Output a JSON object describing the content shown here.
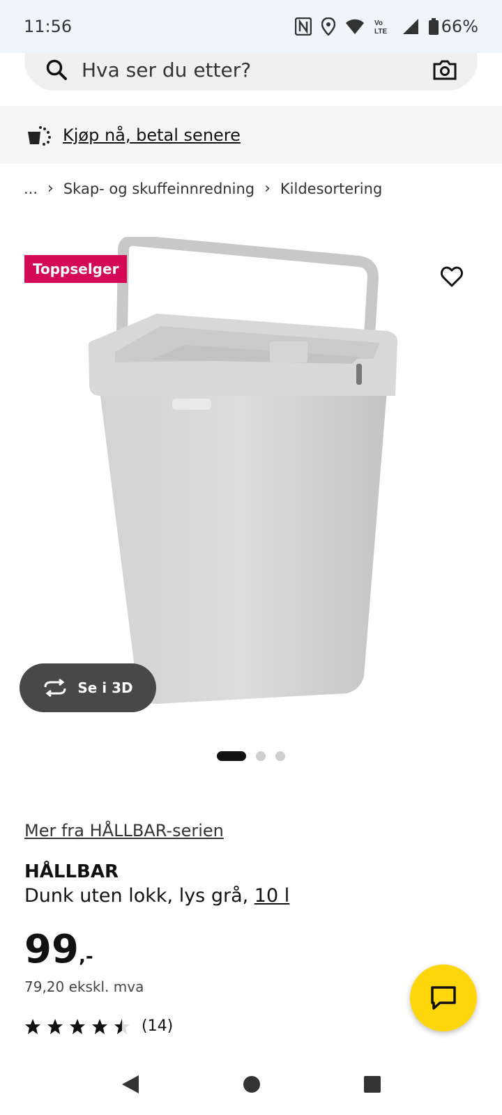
{
  "status_bar": {
    "time": "11:56",
    "battery": "66%"
  },
  "search": {
    "placeholder": "Hva ser du etter?"
  },
  "promo": {
    "text": "Kjøp nå, betal senere"
  },
  "breadcrumb": {
    "ellipsis": "...",
    "items": [
      "Skap- og skuffeinnredning",
      "Kildesortering"
    ]
  },
  "product_image": {
    "badge": "Toppselger",
    "view_3d": "Se i 3D",
    "carousel": {
      "count": 3,
      "active": 1
    }
  },
  "product": {
    "series_link": "Mer fra HÅLLBAR-serien",
    "name": "HÅLLBAR",
    "description": "Dunk uten lokk, lys grå,",
    "size": "10 l",
    "price": "99",
    "price_suffix": ",-",
    "price_ex_vat": "79,20 ekskl. mva",
    "rating": 4.5,
    "review_count": "(14)"
  },
  "colors": {
    "badge": "#d40a58",
    "chat": "#ffd60a",
    "button_3d": "#484848"
  }
}
